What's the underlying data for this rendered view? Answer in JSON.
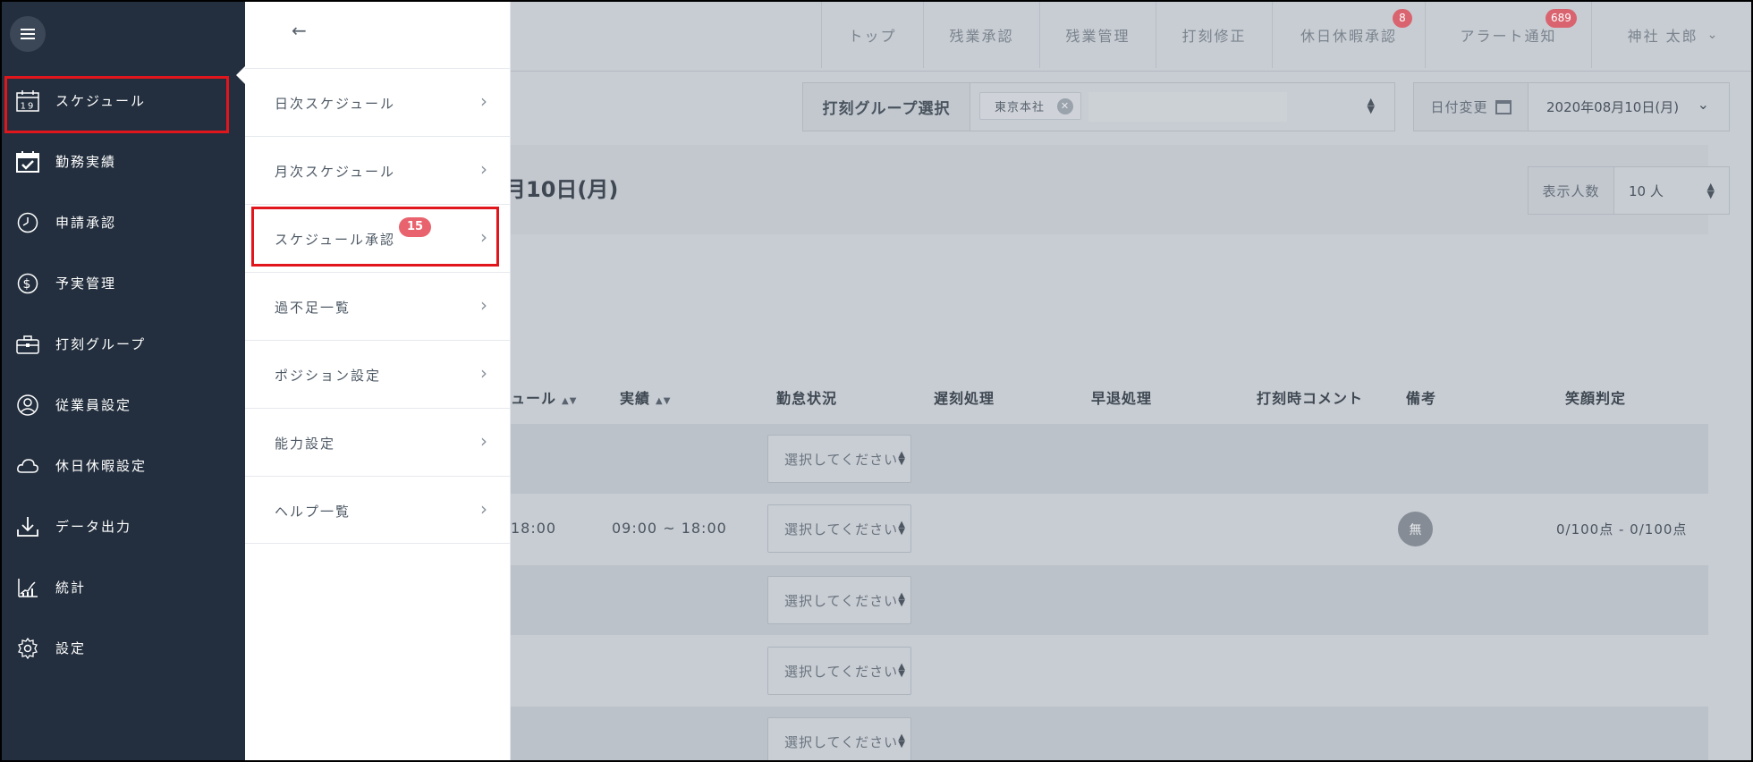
{
  "topnav": {
    "items": [
      {
        "label": "トップ"
      },
      {
        "label": "残業承認"
      },
      {
        "label": "残業管理"
      },
      {
        "label": "打刻修正"
      },
      {
        "label": "休日休暇承認",
        "badge": "8"
      },
      {
        "label": "アラート通知",
        "badge": "689"
      }
    ],
    "user": "神社 太郎"
  },
  "filter": {
    "group_label": "打刻グループ選択",
    "group_tag": "東京本社"
  },
  "date": {
    "change_label": "日付変更",
    "value": "2020年08月10日(月)"
  },
  "page": {
    "date_heading": "月10日(月)",
    "perpage_label": "表示人数",
    "perpage_value": "10 人"
  },
  "table": {
    "headers": [
      "ュール",
      "実績",
      "勤怠状況",
      "遅刻処理",
      "早退処理",
      "打刻時コメント",
      "備考",
      "笑顔判定"
    ],
    "select_placeholder": "選択してください",
    "row2": {
      "schedule": "18:00",
      "actual": "09:00 ~ 18:00",
      "remark": "無",
      "smile": "0/100点 - 0/100点"
    }
  },
  "sidebar": {
    "items": [
      {
        "label": "スケジュール",
        "icon": "calendar-icon"
      },
      {
        "label": "勤務実績",
        "icon": "calendar-check-icon"
      },
      {
        "label": "申請承認",
        "icon": "clock-icon"
      },
      {
        "label": "予実管理",
        "icon": "dollar-icon"
      },
      {
        "label": "打刻グループ",
        "icon": "briefcase-icon"
      },
      {
        "label": "従業員設定",
        "icon": "user-icon"
      },
      {
        "label": "休日休暇設定",
        "icon": "cloud-icon"
      },
      {
        "label": "データ出力",
        "icon": "download-icon"
      },
      {
        "label": "統計",
        "icon": "chart-icon"
      },
      {
        "label": "設定",
        "icon": "gear-icon"
      }
    ]
  },
  "submenu": {
    "items": [
      {
        "label": "日次スケジュール"
      },
      {
        "label": "月次スケジュール"
      },
      {
        "label": "スケジュール承認",
        "badge": "15"
      },
      {
        "label": "過不足一覧"
      },
      {
        "label": "ポジション設定"
      },
      {
        "label": "能力設定"
      },
      {
        "label": "ヘルプ一覧"
      }
    ]
  },
  "colors": {
    "sidebar_bg": "#232f3e",
    "highlight": "#e0161c",
    "badge": "#e8636e"
  }
}
